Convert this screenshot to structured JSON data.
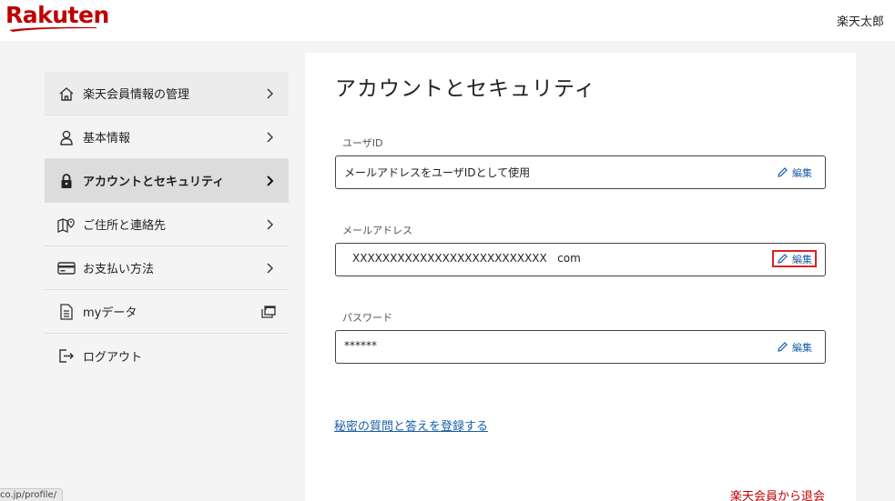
{
  "header": {
    "logo_text": "Rakuten",
    "user_name": "楽天太郎"
  },
  "sidebar": {
    "items": [
      {
        "label": "楽天会員情報の管理",
        "icon": "home-icon"
      },
      {
        "label": "基本情報",
        "icon": "person-icon"
      },
      {
        "label": "アカウントとセキュリティ",
        "icon": "lock-icon"
      },
      {
        "label": "ご住所と連絡先",
        "icon": "map-pin-icon"
      },
      {
        "label": "お支払い方法",
        "icon": "credit-card-icon"
      },
      {
        "label": "myデータ",
        "icon": "document-icon"
      },
      {
        "label": "ログアウト",
        "icon": "logout-icon"
      }
    ]
  },
  "main": {
    "title": "アカウントとセキュリティ",
    "fields": [
      {
        "label": "ユーザID",
        "value": "メールアドレスをユーザIDとして使用",
        "edit_label": "編集"
      },
      {
        "label": "メールアドレス",
        "value": "XXXXXXXXXXXXXXXXXXXXXXXXXX   com",
        "edit_label": "編集"
      },
      {
        "label": "パスワード",
        "value": "******",
        "edit_label": "編集"
      }
    ],
    "secret_question_link": "秘密の質問と答えを登録する",
    "withdraw_link": "楽天会員から退会"
  },
  "status_bar": {
    "url": "co.jp/profile/"
  },
  "colors": {
    "brand": "#bf0000",
    "link": "#1a5fa8",
    "highlight": "#e02020"
  }
}
